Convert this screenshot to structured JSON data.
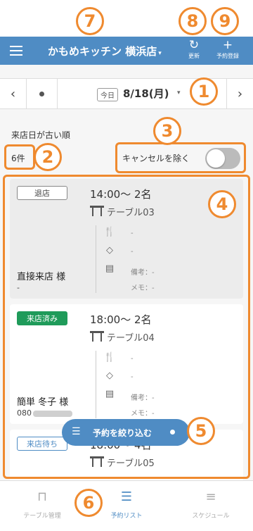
{
  "header": {
    "store_name": "かもめキッチン 横浜店",
    "caret": "▾",
    "menu_icon": "hamburger-menu-icon",
    "refresh_icon": "↻",
    "refresh_label": "更新",
    "add_icon": "+",
    "add_label": "予約登録",
    "color": "#4f8cc4"
  },
  "datebar": {
    "prev": "‹",
    "next": "›",
    "today_chip": "今日",
    "date": "8/18(月)",
    "caret": "▾"
  },
  "list_meta": {
    "sort_label": "来店日が古い順",
    "count": "6件",
    "cancel_filter_label": "キャンセルを除く",
    "cancel_filter_on": false
  },
  "reservations": [
    {
      "status": "退店",
      "time": "14:00〜 2名",
      "table": "テーブル03",
      "food": "-",
      "tag": "-",
      "note": "備考：-",
      "memo": "メモ：-",
      "guest": "直接来店 様",
      "guest_sub": "-"
    },
    {
      "status": "来店済み",
      "time": "18:00〜 2名",
      "table": "テーブル04",
      "food": "-",
      "tag": "-",
      "note": "備考：-",
      "memo": "メモ：-",
      "guest": "簡単 冬子 様",
      "phone_prefix": "080"
    },
    {
      "status": "来店待ち",
      "time": "18:00〜 4名",
      "table": "テーブル05"
    }
  ],
  "filter_button": {
    "label": "予約を絞り込む",
    "icon": "sliders-icon"
  },
  "tabs": [
    {
      "label": "テーブル管理",
      "icon": "table-icon"
    },
    {
      "label": "予約リスト",
      "icon": "list-icon"
    },
    {
      "label": "スケジュール",
      "icon": "schedule-icon"
    }
  ],
  "callouts": [
    "1",
    "2",
    "3",
    "4",
    "5",
    "6",
    "7",
    "8",
    "9"
  ],
  "accent_color": "#ef8a2f"
}
